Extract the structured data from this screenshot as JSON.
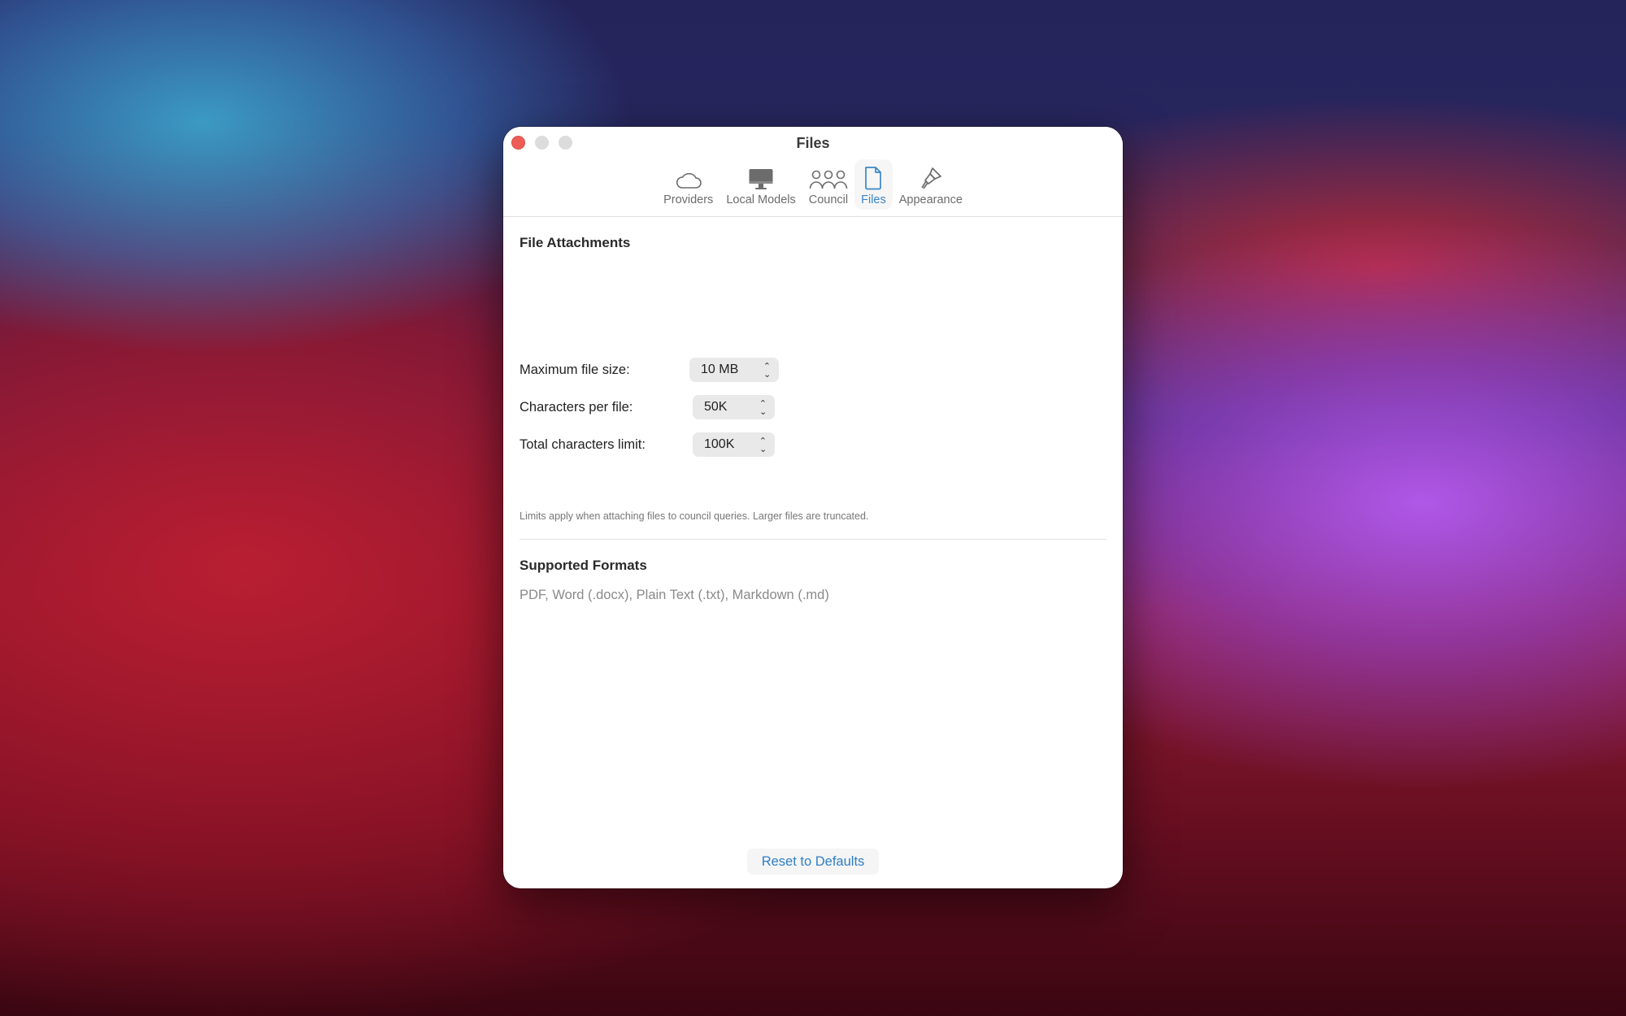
{
  "window": {
    "title": "Files"
  },
  "tabs": [
    {
      "label": "Providers",
      "icon": "cloud-icon"
    },
    {
      "label": "Local Models",
      "icon": "monitor-icon"
    },
    {
      "label": "Council",
      "icon": "people-icon"
    },
    {
      "label": "Files",
      "icon": "document-icon",
      "active": true
    },
    {
      "label": "Appearance",
      "icon": "paintbrush-icon"
    }
  ],
  "file_attachments": {
    "title": "File Attachments",
    "max_file_size": {
      "label": "Maximum file size:",
      "value": "10 MB"
    },
    "chars_per_file": {
      "label": "Characters per file:",
      "value": "50K"
    },
    "total_chars": {
      "label": "Total characters limit:",
      "value": "100K"
    },
    "hint": "Limits apply when attaching files to council queries. Larger files are truncated."
  },
  "supported_formats": {
    "title": "Supported Formats",
    "list": "PDF, Word (.docx), Plain Text (.txt), Markdown (.md)"
  },
  "reset_label": "Reset to Defaults",
  "colors": {
    "accent": "#2f7fc6",
    "close": "#ee5d55"
  }
}
